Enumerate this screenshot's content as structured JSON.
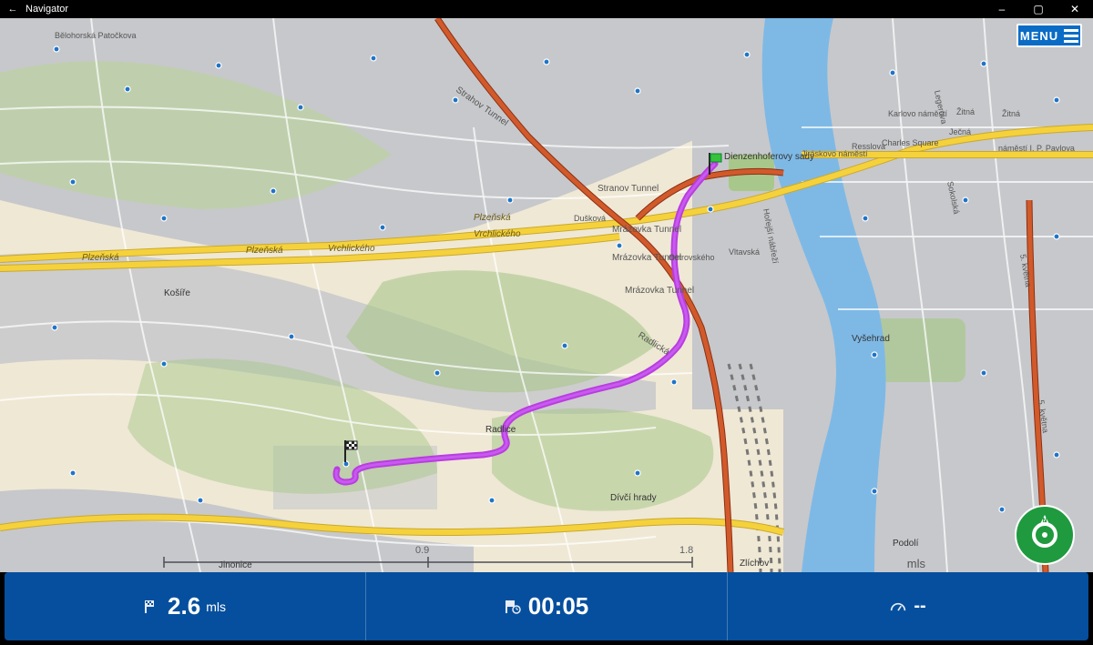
{
  "window": {
    "title": "Navigator"
  },
  "menu": {
    "label": "MENU"
  },
  "compass": {
    "north_letter": "N"
  },
  "mapLabels": {
    "dienzenhoferovy": "Dienzenhoferovy sady",
    "jiraskovo": "Jiráskovo náměstí",
    "resslova": "Resslova",
    "charles": "Charles Square",
    "karlovo": "Karlovo náměstí",
    "jecna": "Ječná",
    "zitna": "Žitná",
    "ipavlova": "náměstí I. P. Pavlova",
    "legerova": "Legerova",
    "sokolska": "Sokolská",
    "kvetnaR": "5. května",
    "kvetnaL": "5. května",
    "vysehrad": "Vyšehrad",
    "podoli": "Podolí",
    "vltavska": "Vltavská",
    "horejsi": "Hořejší nábřeží",
    "ostrovskeho": "Ostrovského",
    "duskova": "Dušková",
    "stranov": "Stranov Tunnel",
    "strahov": "Strahov Tunnel",
    "mrazovka1": "Mrázovka Tunnel",
    "mrazovka2": "Mrázovka Tunnel",
    "mrazovka3": "Mrázovka Tunnel",
    "radlicka": "Radlická",
    "plzenska1": "Plzeňská",
    "plzenska2": "Plzeňská",
    "plzenska3": "Plzeňská",
    "vrchlickeho1": "Vrchlického",
    "vrchlickeho2": "Vrchlického",
    "kosire": "Košíře",
    "radlice": "Radlice",
    "jinonice": "Jinonice",
    "zlichov": "Zlíchov",
    "divcihrady": "Dívčí hrady",
    "belohorskaPatockova": "Bělohorská   Patočkova"
  },
  "scale": {
    "tick1": "0.9",
    "tick2": "1.8",
    "unit": "mls"
  },
  "status": {
    "distance_value": "2.6",
    "distance_unit": "mls",
    "time_value": "00:05",
    "eta_value": "--"
  }
}
